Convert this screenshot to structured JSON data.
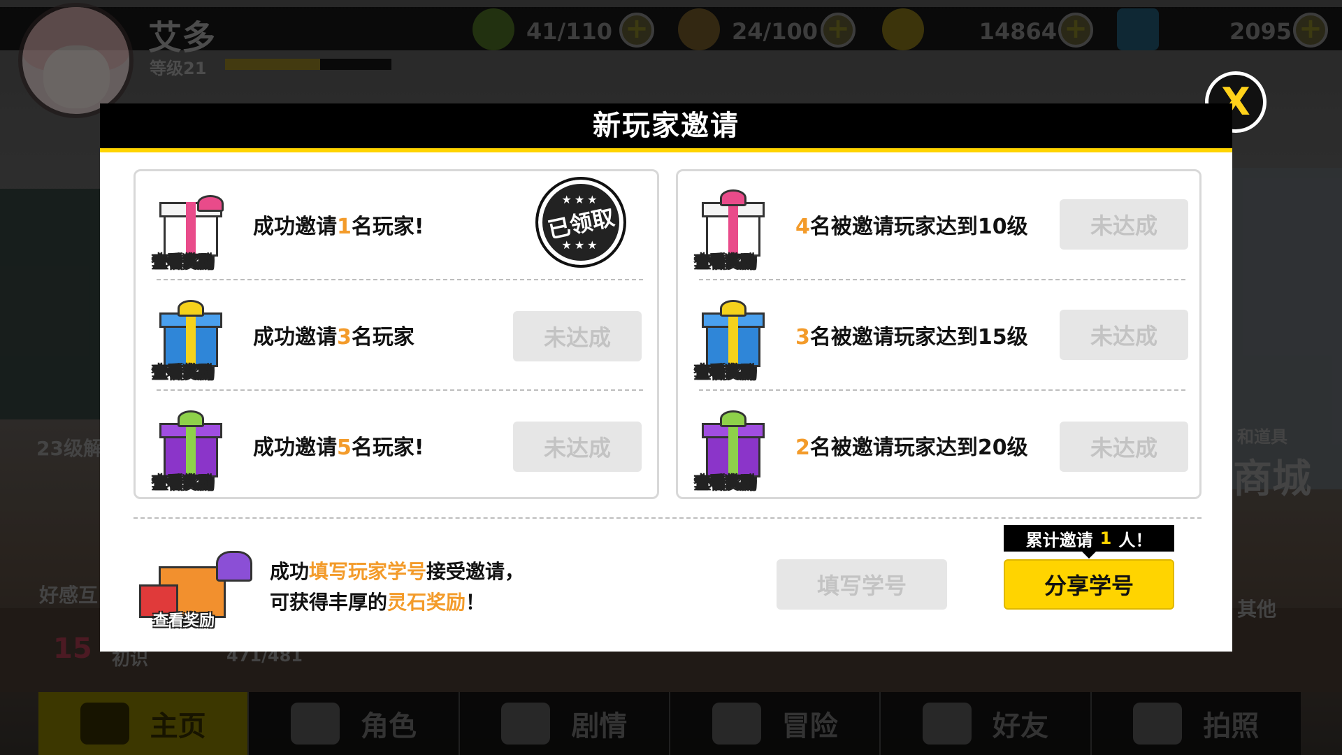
{
  "hud": {
    "player_name": "艾多",
    "level_label": "等级21",
    "exp_progress": 0.57,
    "stamina": "41/110",
    "energy": "24/100",
    "coins": "14864",
    "gems": "2095",
    "plus_label": "+"
  },
  "side": {
    "unlock_label": "23级解",
    "affinity_label": "好感互",
    "affinity_level": "15",
    "affinity_title": "初识",
    "affinity_progress": "471/481",
    "shop_sub": "和道具",
    "shop_label": "商城",
    "other_label": "其他"
  },
  "dialog": {
    "title": "新玩家邀请",
    "close_label": "X",
    "view_reward_label": "查看奖励",
    "left_tasks": [
      {
        "prefix": "成功邀请",
        "num": "1",
        "suffix": "名玩家!",
        "status": "已领取"
      },
      {
        "prefix": "成功邀请",
        "num": "3",
        "suffix": "名玩家",
        "status": "未达成"
      },
      {
        "prefix": "成功邀请",
        "num": "5",
        "suffix": "名玩家!",
        "status": "未达成"
      }
    ],
    "right_tasks": [
      {
        "num": "4",
        "suffix": "名被邀请玩家达到10级",
        "status": "未达成"
      },
      {
        "num": "3",
        "suffix": "名被邀请玩家达到15级",
        "status": "未达成"
      },
      {
        "num": "2",
        "suffix": "名被邀请玩家达到20级",
        "status": "未达成"
      }
    ],
    "invite_line1_a": "成功",
    "invite_line1_hl": "填写玩家学号",
    "invite_line1_b": "接受邀请，",
    "invite_line2_a": "可获得丰厚的",
    "invite_line2_hl": "灵石奖励",
    "invite_line2_b": "！",
    "fill_button": "填写学号",
    "tip_prefix": "累计邀请",
    "tip_count": "1",
    "tip_suffix": "人！",
    "share_button": "分享学号"
  },
  "nav": [
    {
      "label": "主页",
      "icon": "home-icon"
    },
    {
      "label": "角色",
      "icon": "character-icon"
    },
    {
      "label": "剧情",
      "icon": "story-icon"
    },
    {
      "label": "冒险",
      "icon": "map-pin-icon"
    },
    {
      "label": "好友",
      "icon": "chat-icon"
    },
    {
      "label": "拍照",
      "icon": "camera-icon"
    }
  ],
  "colors": {
    "accent": "#ffd400",
    "highlight_number": "#f39b2a",
    "ribbon_pink": "#e94b8a",
    "ribbon_yellow": "#f5d21c",
    "ribbon_green": "#8ed14a",
    "box_blue": "#2f86d8",
    "box_purple": "#8b35c9"
  }
}
